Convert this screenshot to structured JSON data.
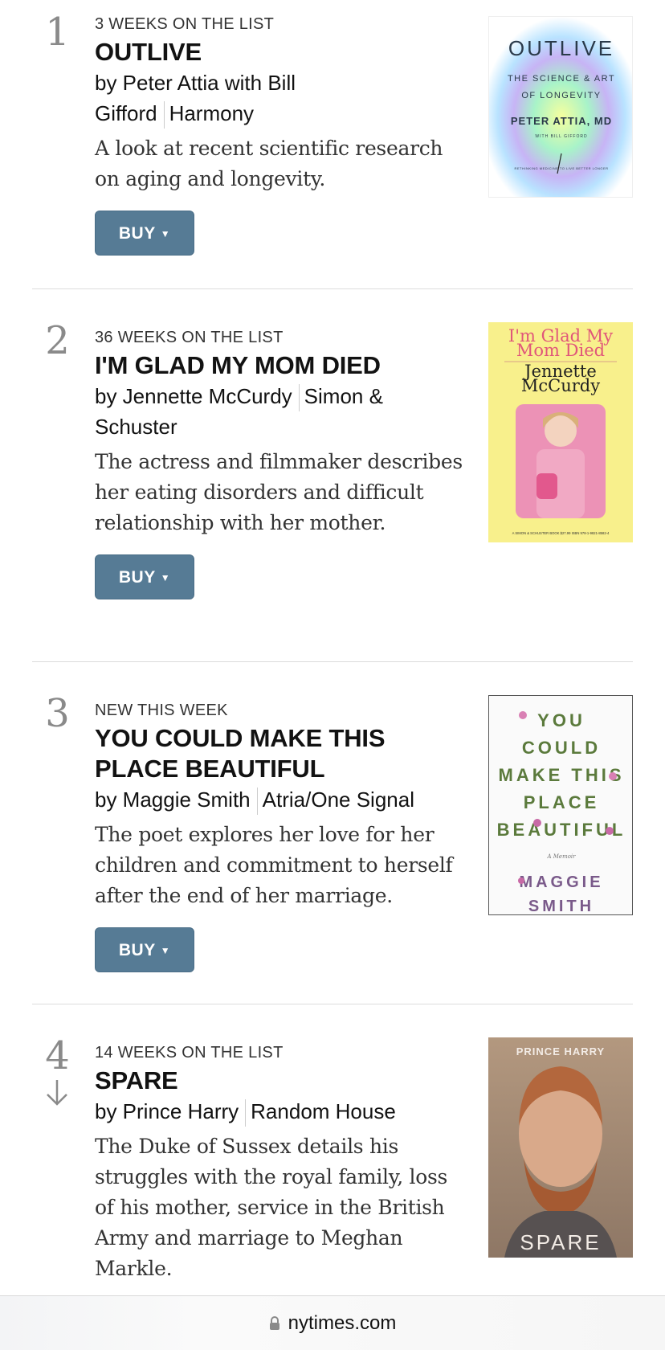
{
  "books": [
    {
      "rank": "1",
      "weeks": "3 WEEKS ON THE LIST",
      "title": "OUTLIVE",
      "author_line1": "by Peter Attia with Bill",
      "author_line2": "Gifford",
      "publisher": "Harmony",
      "description": "A look at recent scientific research on aging and longevity.",
      "buy_label": "BUY",
      "cover": {
        "title": "OUTLIVE",
        "subtitle_1": "THE SCIENCE & ART",
        "subtitle_2": "OF LONGEVITY",
        "author": "PETER ATTIA, MD",
        "coauthor": "WITH BILL GIFFORD",
        "tagline": "RETHINKING MEDICINE TO LIVE BETTER LONGER"
      }
    },
    {
      "rank": "2",
      "weeks": "36 WEEKS ON THE LIST",
      "title": "I'M GLAD MY MOM DIED",
      "author_line1": "by Jennette McCurdy",
      "publisher": "Simon &",
      "publisher_line2": "Schuster",
      "description": "The actress and filmmaker describes her eating disorders and difficult relationship with her mother.",
      "buy_label": "BUY",
      "cover": {
        "title_1": "I'm Glad My",
        "title_2": "Mom Died",
        "author_1": "Jennette",
        "author_2": "McCurdy",
        "footer": "A SIMON & SCHUSTER BOOK   $27.99   ISBN 978-1-9821-8582-4"
      }
    },
    {
      "rank": "3",
      "weeks": "NEW THIS WEEK",
      "title": "YOU COULD MAKE THIS PLACE BEAUTIFUL",
      "author_line1": "by Maggie Smith",
      "publisher": "Atria/One Signal",
      "description": "The poet explores her love for her children and commitment to herself after the end of her marriage.",
      "buy_label": "BUY",
      "cover": {
        "lines": [
          "YOU",
          "COULD",
          "MAKE THIS",
          "PLACE",
          "BEAUTIFUL"
        ],
        "memoir": "A Memoir",
        "author_1": "MAGGIE",
        "author_2": "SMITH"
      }
    },
    {
      "rank": "4",
      "weeks": "14 WEEKS ON THE LIST",
      "title": "SPARE",
      "author_line1": "by Prince Harry",
      "publisher": "Random House",
      "description": "The Duke of Sussex details his struggles with the royal family, loss of his mother, service in the British Army and marriage to Meghan Markle.",
      "cover": {
        "author": "PRINCE HARRY",
        "title": "SPARE"
      }
    }
  ],
  "browser": {
    "url": "nytimes.com"
  },
  "colors": {
    "buy_button": "#567b95",
    "rank_gray": "#8a8a8a",
    "divider": "#dcdcdc"
  },
  "icons": {
    "rank_change": "down-arrow-icon",
    "lock": "lock-icon",
    "buy_dropdown": "triangle-down-icon"
  }
}
